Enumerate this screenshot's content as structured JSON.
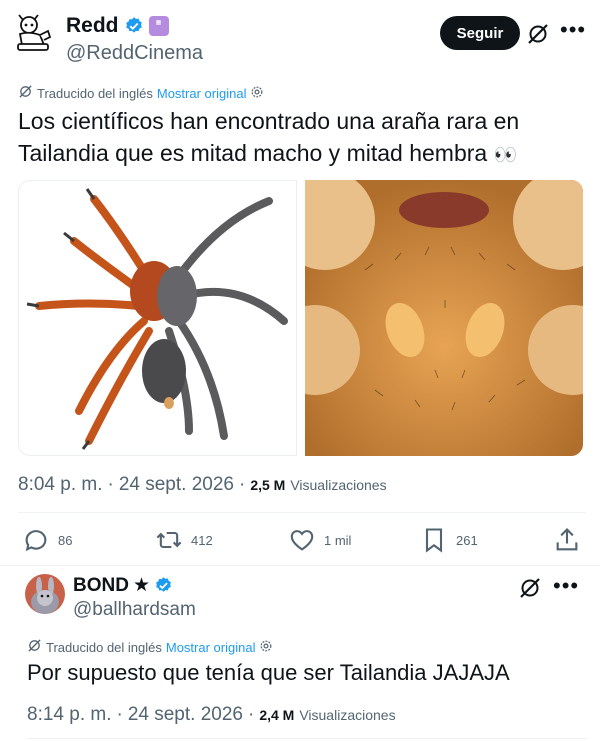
{
  "tweet1": {
    "display_name": "Redd",
    "handle": "@ReddCinema",
    "follow_label": "Seguir",
    "translated_label": "Traducido del inglés",
    "show_original_label": "Mostrar original",
    "text_line1": "Los científicos han encontrado una araña rara en",
    "text_line2": "Tailandia que es mitad macho y mitad hembra",
    "emoji": "👀",
    "time": "8:04 p. m.",
    "separator": "·",
    "date": "24 sept. 2026",
    "views_count": "2,5 M",
    "views_label": "Visualizaciones",
    "replies": "86",
    "reposts": "412",
    "likes": "1 mil",
    "bookmarks": "261",
    "images": [
      "spider-photo",
      "spider-closeup-photo"
    ]
  },
  "tweet2": {
    "display_name": "BOND",
    "star": "★",
    "handle": "@ballhardsam",
    "translated_label": "Traducido del inglés",
    "show_original_label": "Mostrar original",
    "text": "Por supuesto que tenía que ser Tailandia JAJAJA",
    "time": "8:14 p. m.",
    "separator": "·",
    "date": "24 sept. 2026",
    "views_count": "2,4 M",
    "views_label": "Visualizaciones"
  },
  "colors": {
    "verified_blue": "#1d9bf0",
    "link_blue": "#1d9bf0",
    "muted_text": "#536471",
    "primary_text": "#0f1419",
    "follow_bg": "#0f1419"
  },
  "icons": [
    "grok-icon",
    "more-icon",
    "translate-icon",
    "gear-icon",
    "reply-icon",
    "repost-icon",
    "like-icon",
    "bookmark-icon",
    "share-icon",
    "verified-icon"
  ]
}
